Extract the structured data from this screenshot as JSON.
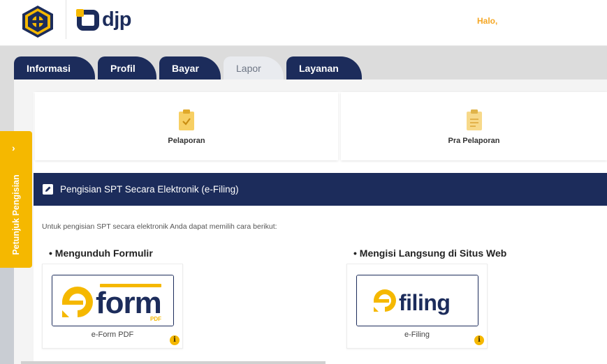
{
  "header": {
    "brand": "djp",
    "greeting": "Halo,"
  },
  "tabs": [
    {
      "label": "Informasi",
      "active": false
    },
    {
      "label": "Profil",
      "active": false
    },
    {
      "label": "Bayar",
      "active": false
    },
    {
      "label": "Lapor",
      "active": true
    },
    {
      "label": "Layanan",
      "active": false
    }
  ],
  "cards": [
    {
      "label": "Pelaporan",
      "icon": "clipboard-check-icon"
    },
    {
      "label": "Pra Pelaporan",
      "icon": "clipboard-list-icon"
    }
  ],
  "section": {
    "title": "Pengisian SPT Secara Elektronik (e-Filing)",
    "intro": "Untuk pengisian SPT secara elektronik Anda dapat memilih cara berikut:"
  },
  "options": [
    {
      "title": "• Mengunduh Formulir",
      "logo_text": "form",
      "logo_sub": "PDF",
      "caption": "e-Form PDF"
    },
    {
      "title": "• Mengisi Langsung di Situs Web",
      "logo_text": "filing",
      "caption": "e-Filing"
    }
  ],
  "side_tab": {
    "label": "Petunjuk Pengisian",
    "chevron": "›"
  },
  "colors": {
    "navy": "#1c2c5b",
    "accent": "#f5b800",
    "greeting": "#f5a623"
  }
}
